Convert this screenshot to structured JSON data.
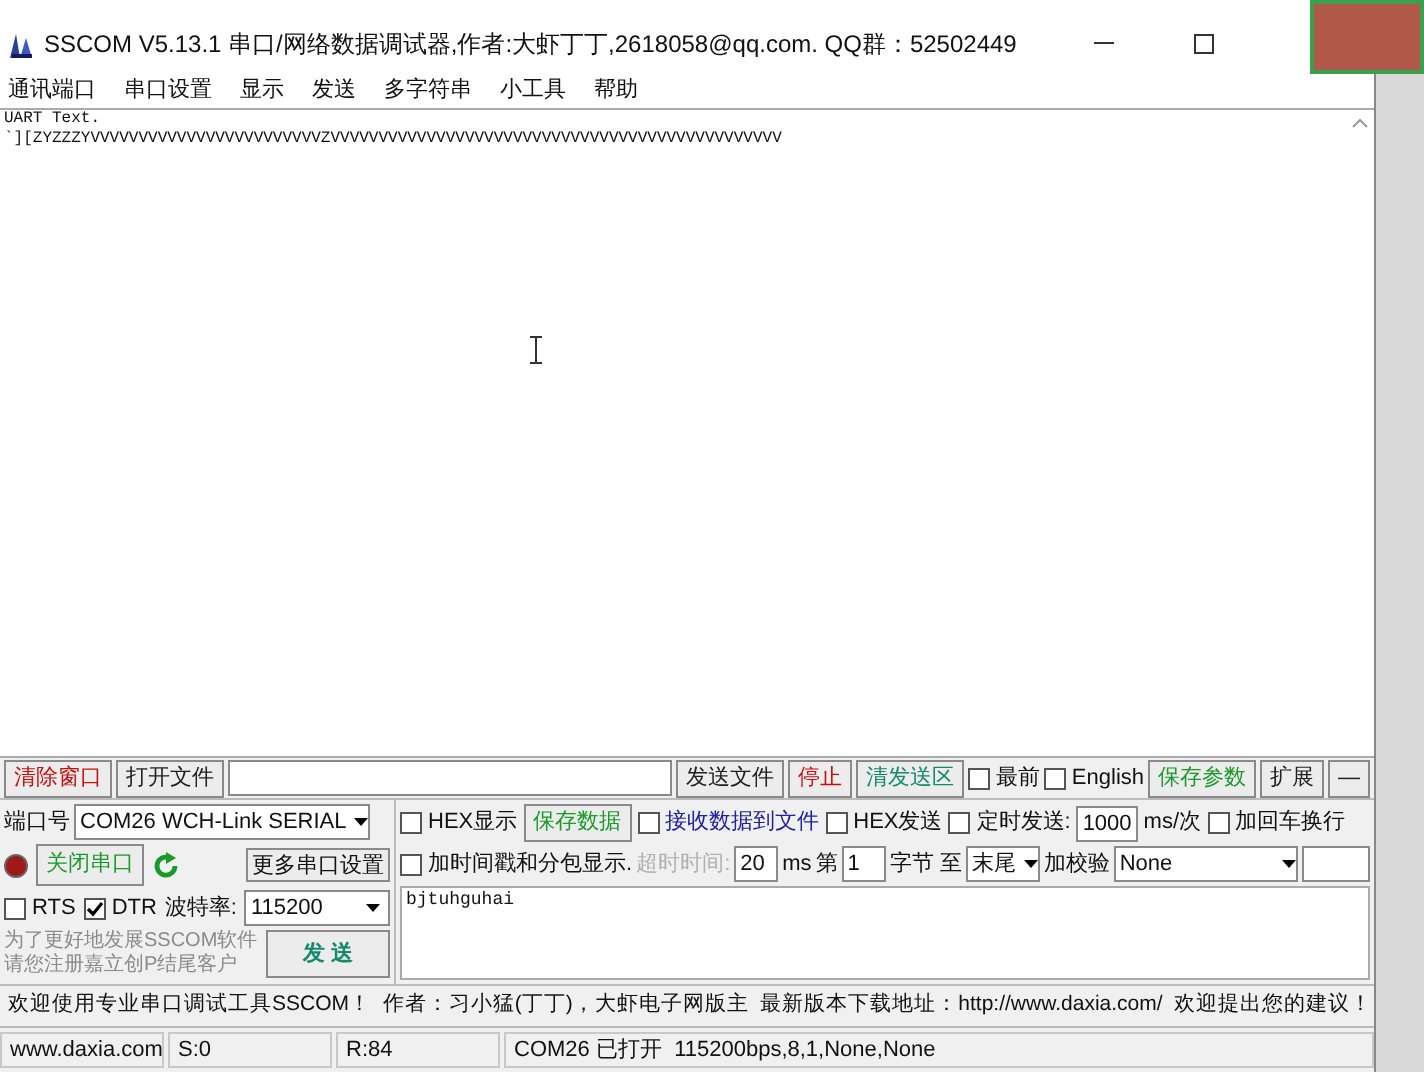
{
  "window": {
    "title": "SSCOM V5.13.1 串口/网络数据调试器,作者:大虾丁丁,2618058@qq.com. QQ群：52502449"
  },
  "menu": [
    "通讯端口",
    "串口设置",
    "显示",
    "发送",
    "多字符串",
    "小工具",
    "帮助"
  ],
  "receive": {
    "lines": [
      "UART Text.",
      "`][ZYZZZYVVVVVVVVVVVVVVVVVVVVVVVVZVVVVVVVVVVVVVVVVVVVVVVVVVVVVVVVVVVVVVVVVVVVVVVV"
    ]
  },
  "toolbar": [
    {
      "kind": "button",
      "label": "清除窗口",
      "color": "#c81010"
    },
    {
      "kind": "button",
      "label": "打开文件",
      "color": "#202020"
    },
    {
      "kind": "field"
    },
    {
      "kind": "button",
      "label": "发送文件",
      "color": "#202020"
    },
    {
      "kind": "button",
      "label": "停止",
      "color": "#c81010"
    },
    {
      "kind": "button",
      "label": "清发送区",
      "color": "#138a6e"
    },
    {
      "kind": "checkbox",
      "label": "最前",
      "checked": false
    },
    {
      "kind": "checkbox",
      "label": "English",
      "checked": false
    },
    {
      "kind": "button",
      "label": "保存参数",
      "color": "#1a9a2a"
    },
    {
      "kind": "button",
      "label": "扩展",
      "color": "#202020"
    },
    {
      "kind": "button",
      "label": "—",
      "color": "#202020"
    }
  ],
  "port": {
    "label": "端口号",
    "value": "COM26 WCH-Link SERIAL",
    "open": true,
    "toggle_button": "关闭串口",
    "more_button": "更多串口设置",
    "rts": {
      "label": "RTS",
      "checked": false
    },
    "dtr": {
      "label": "DTR",
      "checked": true
    },
    "baud_label": "波特率:",
    "baud": "115200",
    "promo": [
      "为了更好地发展SSCOM软件",
      "请您注册嘉立创P结尾客户"
    ],
    "send_button": "发 送"
  },
  "options_row1": [
    {
      "kind": "checkbox",
      "label": "HEX显示",
      "checked": false
    },
    {
      "kind": "button",
      "label": "保存数据",
      "color": "#1a9a2a"
    },
    {
      "kind": "checkbox",
      "label": "接收数据到文件",
      "checked": false,
      "color": "#2020a0"
    },
    {
      "kind": "checkbox",
      "label": "HEX发送",
      "checked": false
    },
    {
      "kind": "checkbox",
      "label": "定时发送:",
      "checked": false
    },
    {
      "kind": "field",
      "value": "1000"
    },
    {
      "kind": "text",
      "label": "ms/次"
    },
    {
      "kind": "checkbox",
      "label": "加回车换行",
      "checked": false
    }
  ],
  "options_row2": [
    {
      "kind": "checkbox",
      "label": "加时间戳和分包显示.",
      "checked": false
    },
    {
      "kind": "text",
      "label": "超时时间:",
      "disabled": true
    },
    {
      "kind": "field",
      "value": "20"
    },
    {
      "kind": "text",
      "label": "ms"
    },
    {
      "kind": "text",
      "label": "第"
    },
    {
      "kind": "field",
      "value": "1"
    },
    {
      "kind": "text",
      "label": "字节 至"
    },
    {
      "kind": "select",
      "value": "末尾"
    },
    {
      "kind": "text",
      "label": "加校验"
    },
    {
      "kind": "combo",
      "value": "None"
    },
    {
      "kind": "field"
    }
  ],
  "send": {
    "value": "bjtuhguhai"
  },
  "welcome": "欢迎使用专业串口调试工具SSCOM！  作者：习小猛(丁丁)，大虾电子网版主  最新版本下载地址：http://www.daxia.com/  欢迎提出您的建议！",
  "status_bar": [
    "www.daxia.com",
    "S:0",
    "R:84",
    "COM26 已打开  115200bps,8,1,None,None"
  ]
}
